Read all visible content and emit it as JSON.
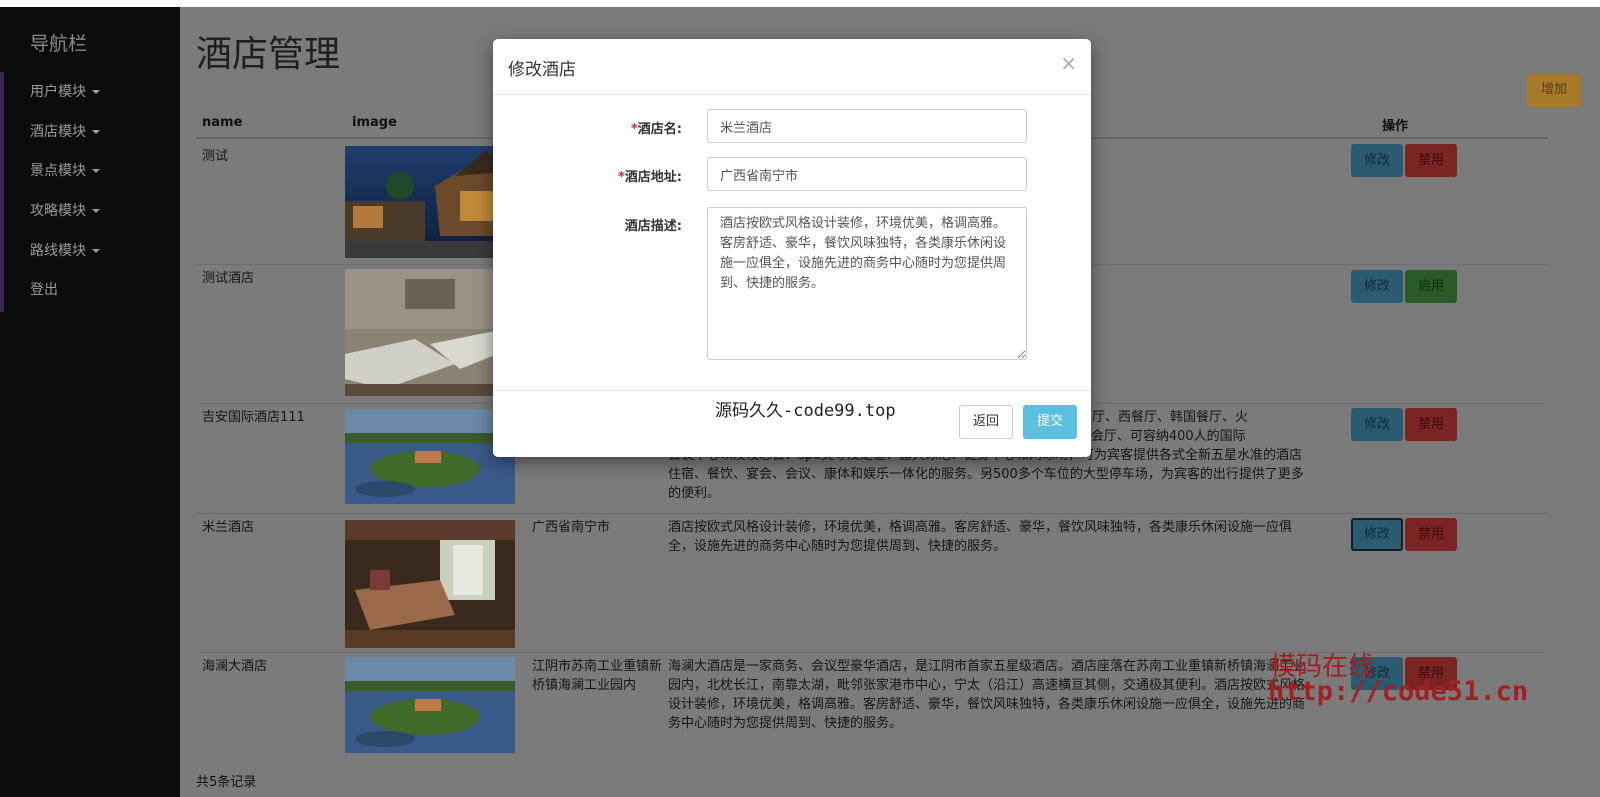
{
  "sidebar": {
    "brand": "导航栏",
    "items": [
      {
        "label": "用户模块",
        "has_caret": true
      },
      {
        "label": "酒店模块",
        "has_caret": true
      },
      {
        "label": "景点模块",
        "has_caret": true
      },
      {
        "label": "攻略模块",
        "has_caret": true
      },
      {
        "label": "路线模块",
        "has_caret": true
      },
      {
        "label": "登出",
        "has_caret": false
      }
    ]
  },
  "page": {
    "title": "酒店管理",
    "add_label": "增加",
    "footer": "共5条记录"
  },
  "table": {
    "headers": {
      "name": "name",
      "image": "image",
      "actions": "操作"
    },
    "rows": [
      {
        "name": "测试",
        "address": "",
        "desc": "",
        "edit": "修改",
        "toggle": "禁用"
      },
      {
        "name": "测试酒店",
        "address": "",
        "desc": "",
        "edit": "修改",
        "toggle": "启用"
      },
      {
        "name": "吉安国际酒店111",
        "address": "",
        "desc_lines": [
          "同，酒店拥有中餐厅、西餐厅、韩国餐厅、火",
          "可接待500人的宴会厅、可容纳400人的国际",
          "会议中心以及校总会、spa美导及足道、露天泳池、健身中心和网球场，可为宾客提供各式全新五星水准的酒店",
          "住宿、餐饮、宴会、会议、康体和娱乐一体化的服务。另500多个车位的大型停车场，为宾客的出行提供了更多",
          "的便利。"
        ],
        "edit": "修改",
        "toggle": "禁用"
      },
      {
        "name": "米兰酒店",
        "address": "广西省南宁市",
        "desc_lines": [
          "酒店按欧式风格设计装修，环境优美，格调高雅。客房舒适、豪华，餐饮风味独特，各类康乐休闲设施一应俱",
          "全，设施先进的商务中心随时为您提供周到、快捷的服务。"
        ],
        "edit": "修改",
        "toggle": "禁用"
      },
      {
        "name": "海澜大酒店",
        "address_lines": [
          "江阴市苏南工业重镇新",
          "桥镇海澜工业园内"
        ],
        "desc_lines": [
          "海澜大酒店是一家商务、会议型豪华酒店，是江阴市首家五星级酒店。酒店座落在苏南工业重镇新桥镇海澜工业",
          "园内，北枕长江，南靠太湖，毗邻张家港市中心，宁太（沿江）高速横亘其侧，交通极其便利。酒店按欧式风格",
          "设计装修，环境优美，格调高雅。客房舒适、豪华，餐饮风味独特，各类康乐休闲设施一应俱全，设施先进的商",
          "务中心随时为您提供周到、快捷的服务。"
        ],
        "edit": "修改",
        "toggle": "禁用"
      }
    ]
  },
  "watermark": {
    "line1": "模码在线",
    "line2": "http://code51.cn"
  },
  "modal": {
    "title": "修改酒店",
    "close": "×",
    "required_mark": "*",
    "name_label": "酒店名:",
    "name_value": "米兰酒店",
    "address_label": "酒店地址:",
    "address_value": "广西省南宁市",
    "desc_label": "酒店描述:",
    "desc_value": "酒店按欧式风格设计装修，环境优美，格调高雅。客房舒适、豪华，餐饮风味独特，各类康乐休闲设施一应俱全，设施先进的商务中心随时为您提供周到、快捷的服务。",
    "footer_watermark": "源码久久-code99.top",
    "back_label": "返回",
    "submit_label": "提交"
  },
  "colors": {
    "sidebar_bg": "#0c0c0d",
    "overlay_page": "#7b7b7b",
    "edit_button": "#5bc0de",
    "ban_button": "#d9534f",
    "enable_button": "#5cb85c",
    "add_button": "#f0ad4e",
    "watermark": "#a41f1f"
  }
}
